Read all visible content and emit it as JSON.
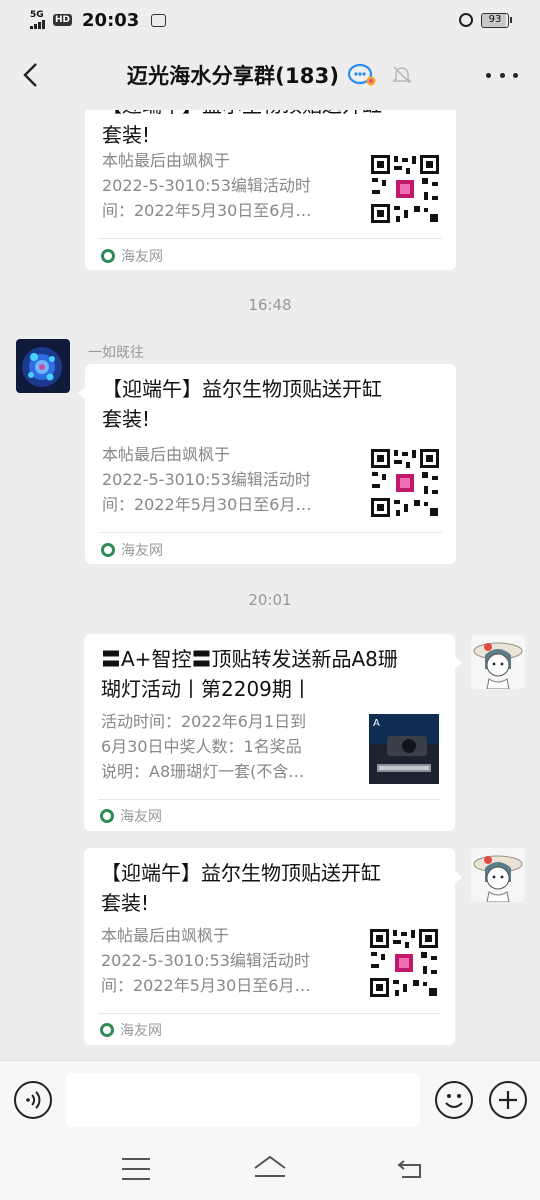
{
  "status_bar": {
    "network": "5G",
    "hd": "HD",
    "time": "20:03",
    "battery": "93"
  },
  "header": {
    "title": "迈光海水分享群(183)"
  },
  "messages": [
    {
      "kind": "card",
      "title": "【迎端午】益尔生物顶贴送开缸套装!",
      "desc": "本帖最后由飒枫于2022-5-3010:53编辑活动时间：2022年5月30日至6月…",
      "source": "海友网",
      "thumb": "qr-code"
    },
    {
      "kind": "time",
      "text": "16:48"
    },
    {
      "kind": "card",
      "sender": "一如既往",
      "title": "【迎端午】益尔生物顶贴送开缸套装!",
      "desc": "本帖最后由飒枫于2022-5-3010:53编辑活动时间：2022年5月30日至6月…",
      "source": "海友网",
      "thumb": "qr-code"
    },
    {
      "kind": "time",
      "text": "20:01"
    },
    {
      "kind": "card",
      "title": "〓A+智控〓顶贴转发送新品A8珊瑚灯活动丨第2209期丨",
      "desc": "活动时间：2022年6月1日到6月30日中奖人数：1名奖品说明：A8珊瑚灯一套(不含…",
      "source": "海友网",
      "thumb": "product-photo"
    },
    {
      "kind": "card",
      "title": "【迎端午】益尔生物顶贴送开缸套装!",
      "desc": "本帖最后由飒枫于2022-5-3010:53编辑活动时间：2022年5月30日至6月…",
      "source": "海友网",
      "thumb": "qr-code"
    }
  ],
  "card_text": {
    "title_top_partial": "【迎端午】益尔生物顶贴送开缸",
    "title_line2": "套装!",
    "desc_l1": "本帖最后由飒枫于",
    "desc_l2": "2022-5-3010:53编辑活动时",
    "desc_l3": "间：2022年5月30日至6月…",
    "a8_title_l1": "〓A+智控〓顶贴转发送新品A8珊",
    "a8_title_l2": "瑚灯活动丨第2209期丨",
    "a8_desc_l1": "活动时间：2022年6月1日到",
    "a8_desc_l2": "6月30日中奖人数：1名奖品",
    "a8_desc_l3": "说明：A8珊瑚灯一套(不含…",
    "source": "海友网",
    "ts1": "16:48",
    "ts2": "20:01",
    "sender": "一如既往",
    "title_full_l1": "【迎端午】益尔生物顶贴送开缸"
  },
  "icons": {
    "back": "chevron-left-icon",
    "group_badge": "group-chat-icon",
    "mute": "bell-off-icon",
    "more": "more-dots-icon",
    "voice": "voice-icon",
    "emoji": "emoji-icon",
    "plus": "plus-icon"
  }
}
